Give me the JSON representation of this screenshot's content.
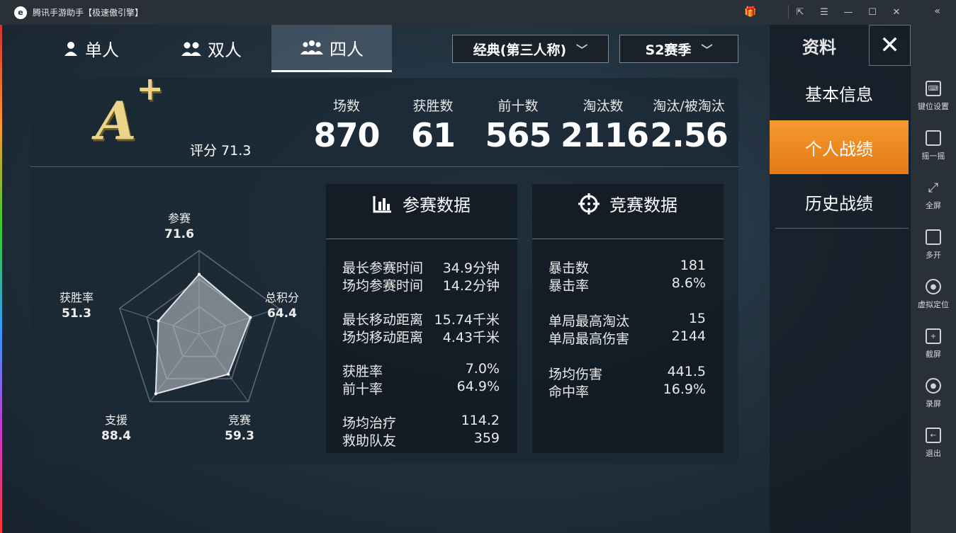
{
  "window": {
    "title": "腾讯手游助手【极速傲引擎】",
    "controls": [
      "restore-icon",
      "menu-icon",
      "minimize-icon",
      "maximize-icon",
      "close-icon"
    ]
  },
  "toolbar": {
    "items": [
      {
        "label": "键位设置",
        "icon": "keyboard-icon"
      },
      {
        "label": "摇一摇",
        "icon": "shake-icon"
      },
      {
        "label": "全屏",
        "icon": "fullscreen-icon"
      },
      {
        "label": "多开",
        "icon": "multi-window-icon"
      },
      {
        "label": "虚拟定位",
        "icon": "location-icon"
      },
      {
        "label": "截屏",
        "icon": "screenshot-icon"
      },
      {
        "label": "录屏",
        "icon": "record-icon"
      },
      {
        "label": "退出",
        "icon": "exit-icon"
      }
    ]
  },
  "modes": [
    {
      "label": "单人",
      "active": false
    },
    {
      "label": "双人",
      "active": false
    },
    {
      "label": "四人",
      "active": true
    }
  ],
  "selectors": {
    "perspective": "经典(第三人称)",
    "season": "S2赛季"
  },
  "summary": {
    "grade": "A",
    "grade_plus": "+",
    "rating_label": "评分 71.3",
    "stats": [
      {
        "label": "场数",
        "value": "870"
      },
      {
        "label": "获胜数",
        "value": "61"
      },
      {
        "label": "前十数",
        "value": "565"
      },
      {
        "label": "淘汰数",
        "value": "2116"
      },
      {
        "label": "淘汰/被淘汰",
        "value": "2.56"
      }
    ]
  },
  "radar": {
    "axes": [
      {
        "label": "参赛",
        "value": "71.6",
        "score": 71.6
      },
      {
        "label": "总积分",
        "value": "64.4",
        "score": 64.4
      },
      {
        "label": "竞赛",
        "value": "59.3",
        "score": 59.3
      },
      {
        "label": "支援",
        "value": "88.4",
        "score": 88.4
      },
      {
        "label": "获胜率",
        "value": "51.3",
        "score": 51.3
      }
    ]
  },
  "participation": {
    "title": "参赛数据",
    "rows": [
      {
        "label": "最长参赛时间",
        "value": "34.9分钟"
      },
      {
        "label": "场均参赛时间",
        "value": "14.2分钟"
      },
      {
        "label": "最长移动距离",
        "value": "15.74千米"
      },
      {
        "label": "场均移动距离",
        "value": "4.43千米"
      },
      {
        "label": "获胜率",
        "value": "7.0%"
      },
      {
        "label": "前十率",
        "value": "64.9%"
      },
      {
        "label": "场均治疗",
        "value": "114.2"
      },
      {
        "label": "救助队友",
        "value": "359"
      }
    ]
  },
  "competition": {
    "title": "竞赛数据",
    "rows": [
      {
        "label": "暴击数",
        "value": "181"
      },
      {
        "label": "暴击率",
        "value": "8.6%"
      },
      {
        "label": "单局最高淘汰",
        "value": "15"
      },
      {
        "label": "单局最高伤害",
        "value": "2144"
      },
      {
        "label": "场均伤害",
        "value": "441.5"
      },
      {
        "label": "命中率",
        "value": "16.9%"
      }
    ]
  },
  "sidebar": {
    "header": "资料",
    "items": [
      {
        "label": "基本信息",
        "active": false
      },
      {
        "label": "个人战绩",
        "active": true
      },
      {
        "label": "历史战绩",
        "active": false
      }
    ]
  },
  "colors": {
    "accent": "#ee8a22",
    "grade": "#e9d48a"
  }
}
